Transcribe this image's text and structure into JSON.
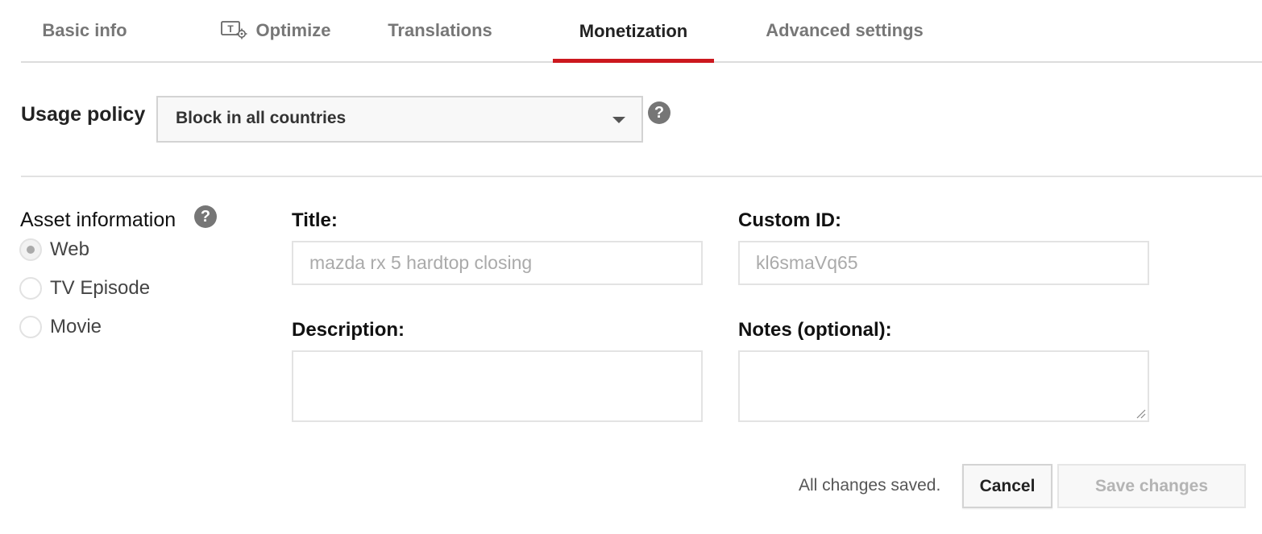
{
  "tabs": [
    {
      "label": "Basic info",
      "active": false
    },
    {
      "label": "Optimize",
      "active": false
    },
    {
      "label": "Translations",
      "active": false
    },
    {
      "label": "Monetization",
      "active": true
    },
    {
      "label": "Advanced settings",
      "active": false
    }
  ],
  "usage_policy": {
    "label": "Usage policy",
    "selected": "Block in all countries",
    "help": "?"
  },
  "asset": {
    "label": "Asset information",
    "help": "?",
    "types": [
      {
        "label": "Web",
        "checked": true
      },
      {
        "label": "TV Episode",
        "checked": false
      },
      {
        "label": "Movie",
        "checked": false
      }
    ]
  },
  "fields": {
    "title_label": "Title:",
    "title_value": "mazda rx 5 hardtop closing",
    "custom_id_label": "Custom ID:",
    "custom_id_value": "kl6smaVq65",
    "description_label": "Description:",
    "description_value": "",
    "notes_label": "Notes (optional):",
    "notes_value": ""
  },
  "footer": {
    "status": "All changes saved.",
    "cancel": "Cancel",
    "save": "Save changes"
  },
  "colors": {
    "accent": "#cc181e",
    "help_icon": "#767676"
  },
  "icons": {
    "optimize_tab": "text-gear-icon",
    "help": "question-circle-icon",
    "dropdown": "caret-down-icon"
  }
}
